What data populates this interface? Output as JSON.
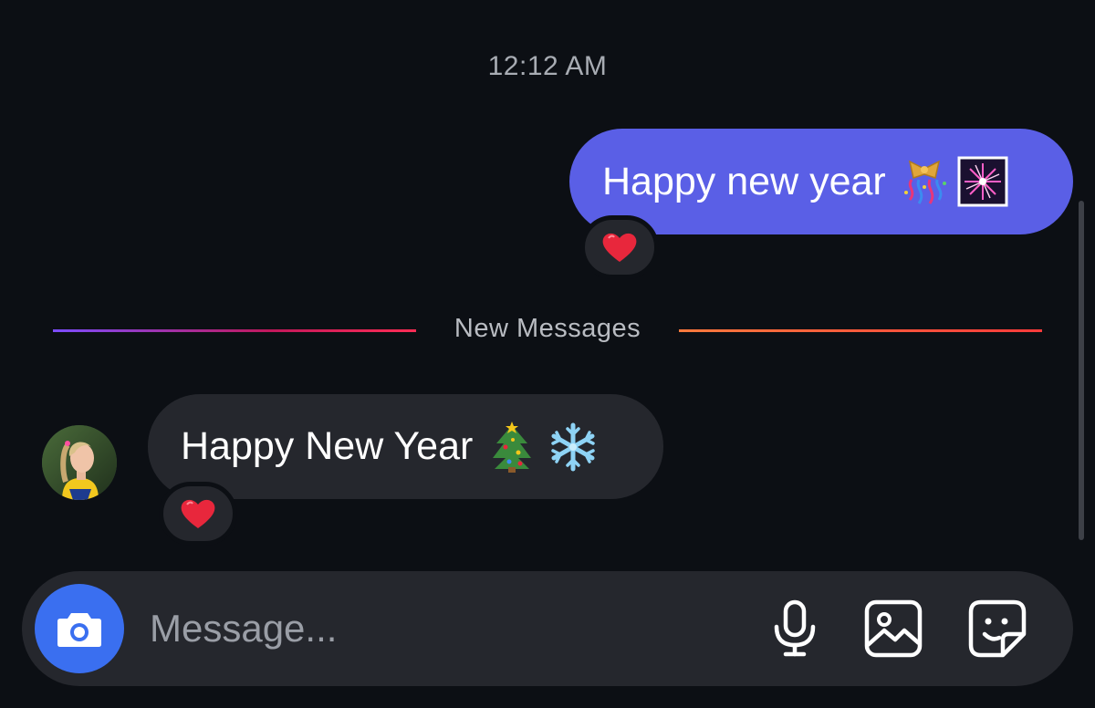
{
  "chat": {
    "timestamp": "12:12 AM",
    "outgoing": {
      "text": "Happy new year",
      "emojis": [
        "confetti-ball-emoji",
        "fireworks-emoji"
      ],
      "reaction": "heart",
      "bubble_color": "#5a5fe6"
    },
    "divider": {
      "label": "New Messages",
      "gradient_left": [
        "#7c4dff",
        "#ff2d55"
      ],
      "gradient_right": [
        "#ff7a3d",
        "#ff3b3b"
      ]
    },
    "incoming": {
      "text": "Happy New Year",
      "emojis": [
        "christmas-tree-emoji",
        "snowflake-emoji"
      ],
      "reaction": "heart",
      "bubble_color": "#25272d"
    }
  },
  "composer": {
    "placeholder": "Message...",
    "value": "",
    "icons": [
      "camera-icon",
      "microphone-icon",
      "gallery-icon",
      "sticker-icon"
    ],
    "camera_button_color": "#3a6ff0"
  },
  "colors": {
    "background": "#0c0f14",
    "reaction_heart": "#e8273c"
  }
}
